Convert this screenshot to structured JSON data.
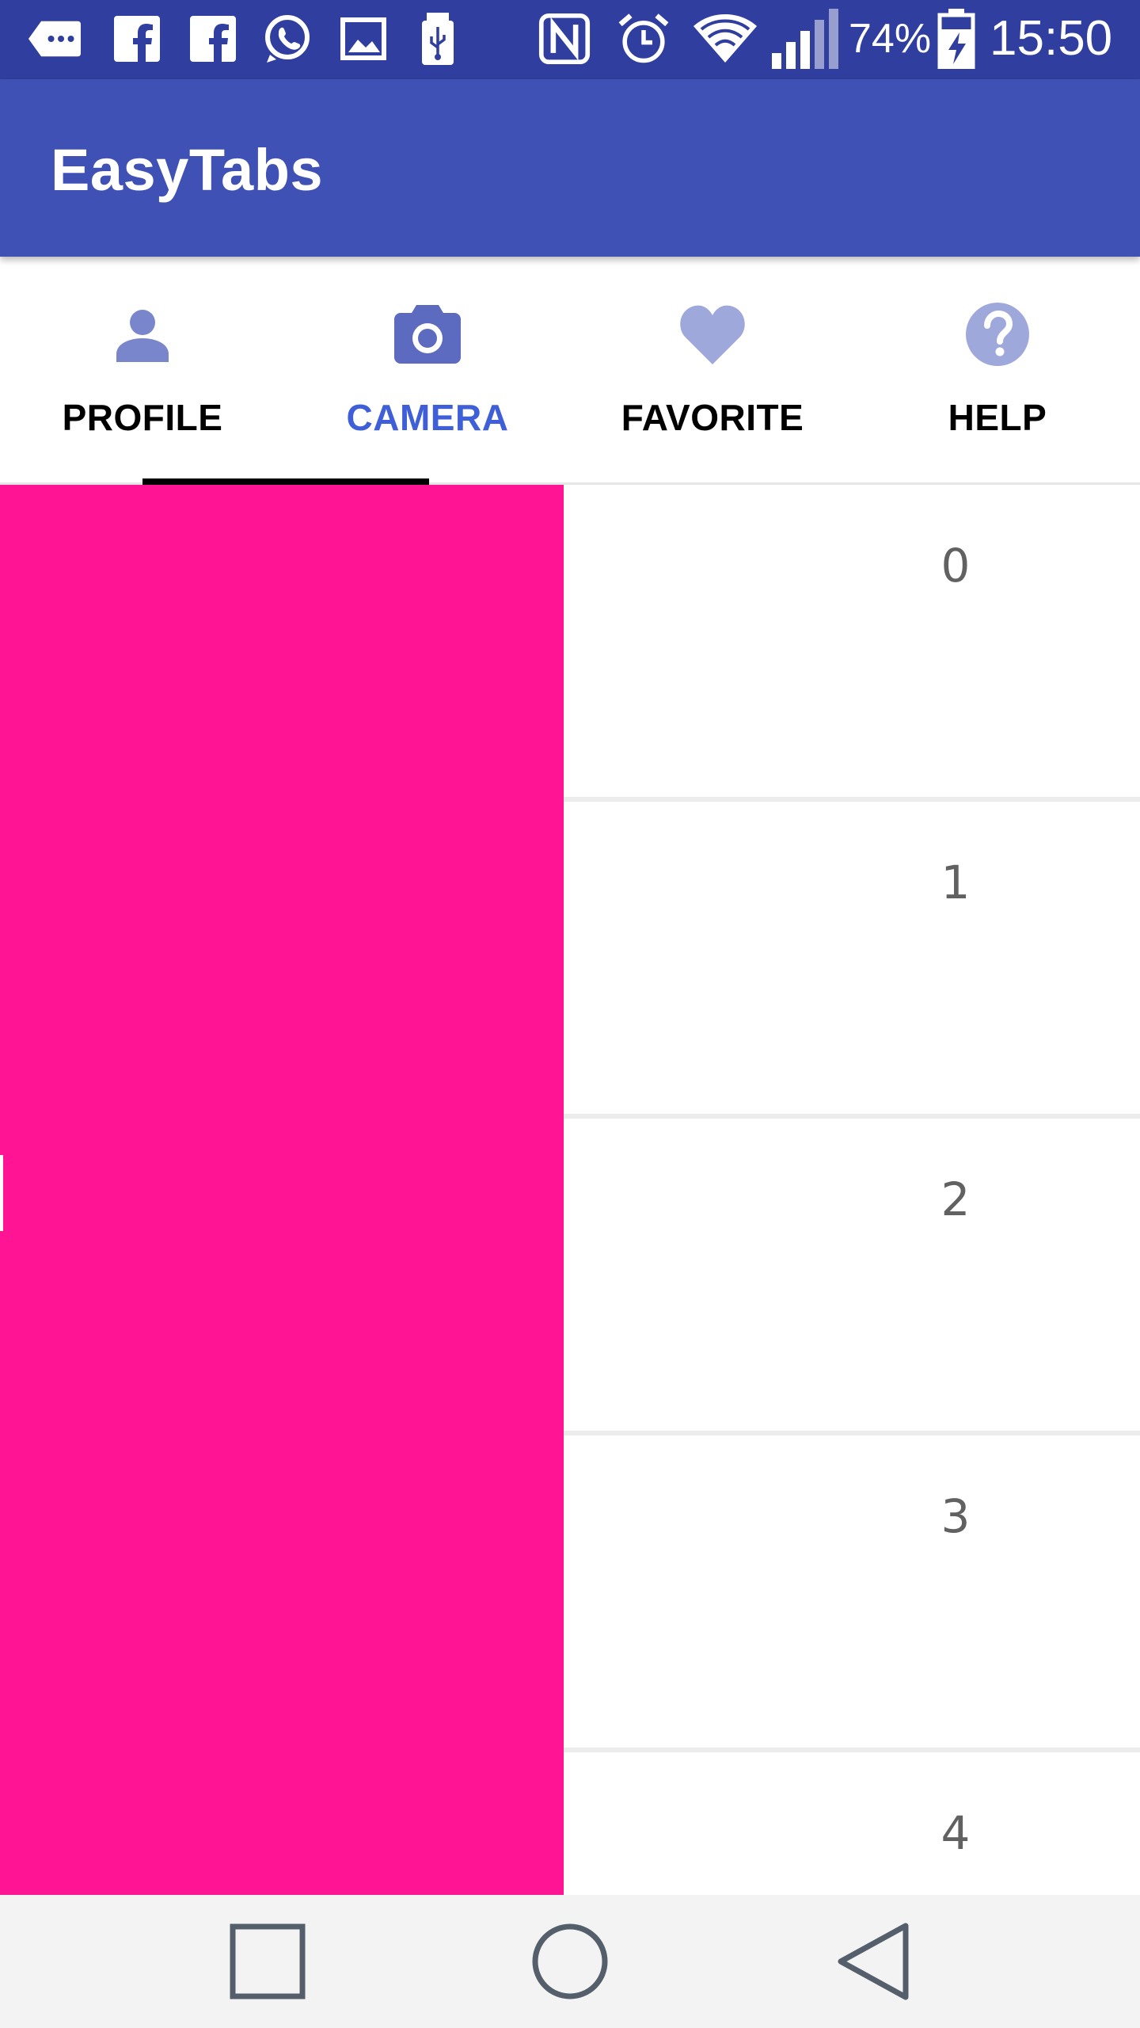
{
  "status_bar": {
    "battery_percent": "74%",
    "time": "15:50",
    "icons": [
      "message-icon",
      "facebook-icon",
      "facebook-icon",
      "whatsapp-icon",
      "gallery-icon",
      "usb-icon",
      "nfc-icon",
      "alarm-icon",
      "wifi-icon",
      "signal-icon",
      "battery-charging-icon"
    ]
  },
  "app_bar": {
    "title": "EasyTabs"
  },
  "tabs": [
    {
      "label": "PROFILE",
      "icon": "person-icon",
      "selected": false
    },
    {
      "label": "CAMERA",
      "icon": "camera-icon",
      "selected": true
    },
    {
      "label": "FAVORITE",
      "icon": "heart-icon",
      "selected": false
    },
    {
      "label": "HELP",
      "icon": "help-icon",
      "selected": false
    }
  ],
  "list": {
    "items": [
      "0",
      "1",
      "2",
      "3",
      "4"
    ]
  },
  "colors": {
    "status_bar": "#303f9f",
    "app_bar": "#3f51b5",
    "active_tab_label": "#3f5fd8",
    "tab_icon": "#7986cb",
    "pink_panel": "#ff1593",
    "nav_bar": "#f3f3f3"
  },
  "nav_bar": {
    "buttons": [
      "recents-button",
      "home-button",
      "back-button"
    ]
  }
}
